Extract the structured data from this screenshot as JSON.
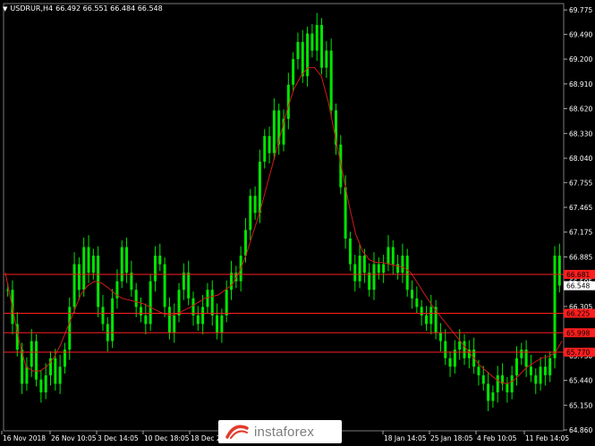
{
  "title": {
    "symbol": "USDRUR,H4",
    "ohlc": "66.492 66.551 66.484 66.548"
  },
  "logo": {
    "text": "instaforex"
  },
  "colors": {
    "background": "#000000",
    "candle": "#00e600",
    "moving_average": "#d41a1a",
    "level_line": "#ff1f1f",
    "price_axis_text": "#ffffff",
    "grid": "#3d3d3d"
  },
  "chart_data": {
    "type": "line",
    "chart_style": "bar-candles",
    "ylim": [
      64.85,
      69.85
    ],
    "y_ticks": [
      "69.775",
      "69.490",
      "69.200",
      "68.910",
      "68.620",
      "68.330",
      "68.040",
      "67.755",
      "67.465",
      "67.175",
      "66.885",
      "66.595",
      "66.305",
      "66.015",
      "65.730",
      "65.440",
      "65.150",
      "64.860"
    ],
    "x_ticks": [
      "16 Nov 2018",
      "26 Nov 10:05",
      "3 Dec 14:05",
      "10 Dec 18:05",
      "18 Dec 22:05",
      "18 Jan 14:05",
      "25 Jan 18:05",
      "4 Feb 10:05",
      "11 Feb 14:05"
    ],
    "levels": [
      {
        "value": 66.681,
        "label": "66.681"
      },
      {
        "value": 66.225,
        "label": "66.225"
      },
      {
        "value": 65.998,
        "label": "65.998"
      },
      {
        "value": 65.77,
        "label": "65.770"
      }
    ],
    "current_price": {
      "value": 66.548,
      "label": "66.548"
    },
    "close_series": {
      "name": "",
      "values": [
        66.5,
        66.1,
        65.8,
        65.4,
        65.6,
        65.9,
        65.45,
        65.3,
        65.5,
        65.7,
        65.4,
        65.6,
        65.8,
        66.3,
        66.8,
        66.5,
        67.0,
        66.7,
        66.9,
        66.3,
        66.1,
        65.9,
        66.4,
        66.6,
        67.0,
        66.7,
        66.5,
        66.3,
        66.2,
        66.1,
        66.6,
        66.9,
        66.8,
        66.3,
        66.0,
        66.2,
        66.5,
        66.7,
        66.4,
        66.2,
        66.1,
        66.3,
        66.5,
        66.2,
        66.0,
        66.2,
        66.5,
        66.7,
        66.6,
        66.9,
        67.2,
        67.6,
        67.4,
        68.0,
        68.3,
        68.1,
        68.6,
        68.2,
        68.5,
        68.9,
        69.2,
        69.4,
        69.0,
        69.5,
        69.3,
        69.6,
        69.1,
        69.3,
        68.6,
        68.2,
        67.7,
        67.1,
        66.8,
        66.6,
        66.9,
        66.7,
        66.5,
        66.8,
        66.7,
        66.8,
        67.0,
        66.8,
        66.7,
        66.9,
        66.5,
        66.4,
        66.3,
        66.2,
        66.1,
        66.3,
        66.0,
        65.9,
        65.7,
        65.6,
        65.8,
        65.9,
        65.7,
        65.8,
        65.6,
        65.5,
        65.4,
        65.2,
        65.3,
        65.5,
        65.4,
        65.3,
        65.5,
        65.7,
        65.8,
        65.6,
        65.5,
        65.4,
        65.6,
        65.5,
        65.7,
        66.9,
        66.55
      ]
    },
    "ma_series": {
      "name": "",
      "values": [
        66.7,
        66.3,
        65.9,
        65.6,
        65.55,
        65.55,
        65.6,
        65.7,
        65.85,
        66.05,
        66.25,
        66.45,
        66.55,
        66.6,
        66.58,
        66.52,
        66.45,
        66.4,
        66.38,
        66.36,
        66.34,
        66.3,
        66.26,
        66.22,
        66.2,
        66.22,
        66.26,
        66.3,
        66.35,
        66.4,
        66.42,
        66.44,
        66.5,
        66.56,
        66.7,
        66.9,
        67.15,
        67.4,
        67.7,
        68.0,
        68.3,
        68.6,
        68.85,
        69.0,
        69.1,
        69.1,
        69.0,
        68.7,
        68.3,
        67.9,
        67.5,
        67.15,
        66.95,
        66.85,
        66.82,
        66.82,
        66.8,
        66.78,
        66.76,
        66.7,
        66.58,
        66.45,
        66.33,
        66.22,
        66.12,
        66.02,
        65.92,
        65.82,
        65.72,
        65.62,
        65.55,
        65.48,
        65.42,
        65.4,
        65.44,
        65.52,
        65.6,
        65.65,
        65.7,
        65.72,
        65.76,
        65.9
      ]
    }
  }
}
